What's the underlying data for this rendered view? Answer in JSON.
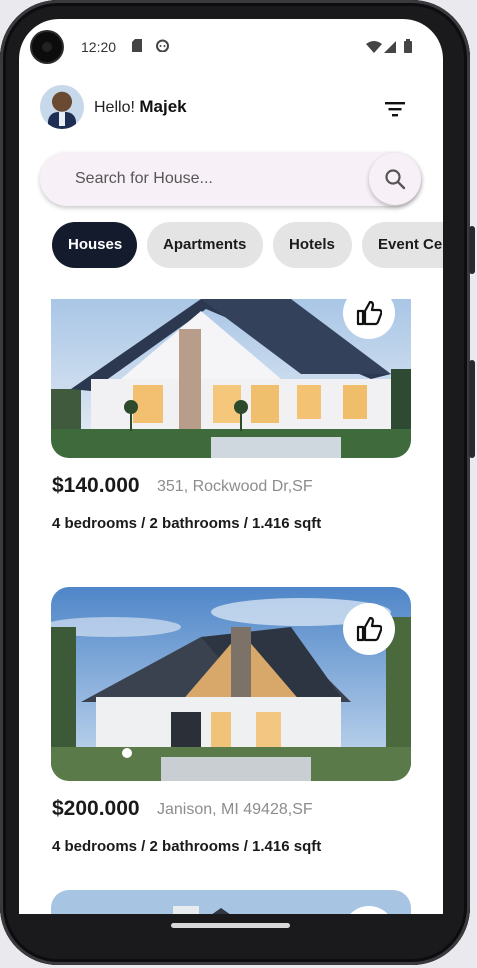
{
  "status_bar": {
    "time": "12:20"
  },
  "header": {
    "greeting": "Hello!",
    "user_name": "Majek"
  },
  "search": {
    "placeholder": "Search for House..."
  },
  "categories": [
    {
      "label": "Houses",
      "active": true
    },
    {
      "label": "Apartments",
      "active": false
    },
    {
      "label": "Hotels",
      "active": false
    },
    {
      "label": "Event Centers",
      "active": false
    }
  ],
  "listings": [
    {
      "price": "$140.000",
      "address": "351, Rockwood Dr,SF",
      "specs": "4 bedrooms / 2 bathrooms / 1.416 sqft"
    },
    {
      "price": "$200.000",
      "address": "Janison, MI 49428,SF",
      "specs": "4 bedrooms / 2 bathrooms / 1.416 sqft"
    },
    {
      "price": "",
      "address": "",
      "specs": ""
    }
  ],
  "colors": {
    "accent": "#141b2d",
    "chip_inactive": "#e4e4e4",
    "search_bg": "#f7f1f7"
  }
}
